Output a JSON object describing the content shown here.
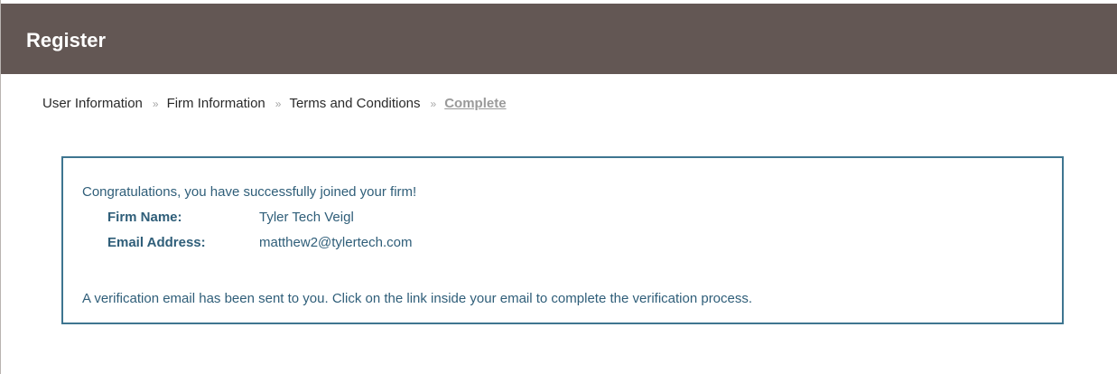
{
  "header": {
    "title": "Register"
  },
  "breadcrumb": {
    "separator": "»",
    "steps": [
      {
        "label": "User Information"
      },
      {
        "label": "Firm Information"
      },
      {
        "label": "Terms and Conditions"
      },
      {
        "label": "Complete",
        "active": true
      }
    ]
  },
  "confirmation": {
    "message": "Congratulations, you have successfully joined your firm!",
    "fields": [
      {
        "label": "Firm Name:",
        "value": "Tyler Tech Veigl"
      },
      {
        "label": "Email Address:",
        "value": "matthew2@tylertech.com"
      }
    ],
    "verification_note": "A verification email has been sent to you. Click on the link inside your email to complete the verification process."
  },
  "colors": {
    "header_bg": "#635754",
    "panel_border": "#3e7590",
    "text_blue": "#2f5e79",
    "active_step": "#9a9a9a"
  }
}
